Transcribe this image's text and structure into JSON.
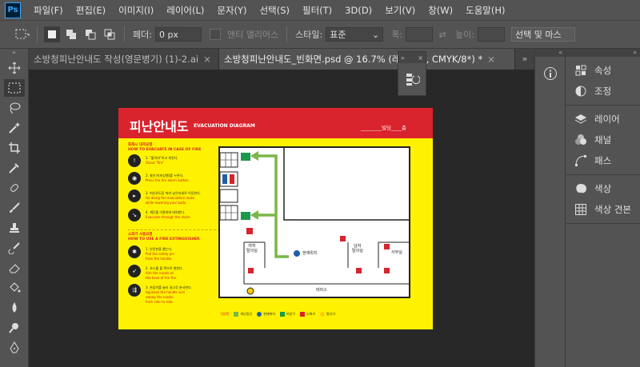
{
  "app": {
    "logo": "Ps"
  },
  "menu": [
    "파일(F)",
    "편집(E)",
    "이미지(I)",
    "레이어(L)",
    "문자(Y)",
    "선택(S)",
    "필터(T)",
    "3D(D)",
    "보기(V)",
    "창(W)",
    "도움말(H)"
  ],
  "options": {
    "feather_label": "페더:",
    "feather_value": "0 px",
    "antialias_label": "앤티 앨리어스",
    "style_label": "스타일:",
    "style_value": "표준",
    "width_label": "폭:",
    "height_label": "높이:",
    "select_mask_label": "선택 및 마스"
  },
  "tabs": [
    {
      "label": "소방청피난안내도 작성(영문병기) (1)-2.ai",
      "active": false
    },
    {
      "label": "소방청피난안내도_빈화면.psd @ 16.7% (레이어 4, CMYK/8*) *",
      "active": true
    }
  ],
  "right_collapsed_icons": [
    "info-icon"
  ],
  "panels": [
    {
      "group": [
        {
          "label": "속성",
          "icon": "properties-icon"
        },
        {
          "label": "조정",
          "icon": "adjustments-icon"
        }
      ]
    },
    {
      "group": [
        {
          "label": "레이어",
          "icon": "layers-icon"
        },
        {
          "label": "채널",
          "icon": "channels-icon"
        },
        {
          "label": "패스",
          "icon": "paths-icon"
        }
      ]
    },
    {
      "group": [
        {
          "label": "색상",
          "icon": "color-icon"
        },
        {
          "label": "색상 견본",
          "icon": "swatches-icon"
        }
      ]
    }
  ],
  "document": {
    "title": "피난안내도",
    "subtitle": "EVACUATION DIAGRAM",
    "floor_line": "________빌딩____층",
    "fire_section": {
      "title_kr": "화재시 대피요령",
      "title_en": "HOW TO EVACUATE IN CASE OF FIRE",
      "steps": [
        {
          "kr": "1. \"불이야\"하고 외친다.",
          "en": "Shout \"fire\""
        },
        {
          "kr": "2. 발신기(비상벨)를 누른다.",
          "en": "Press the fire alarm button."
        },
        {
          "kr": "3. 피난유도등 따라 낮은자세로 이동한다.",
          "en": "Go along the evacuation route",
          "en2": "while lowering your body."
        },
        {
          "kr": "4. 계단을 이용하여 대피한다.",
          "en": "Evacuate through the stairs."
        }
      ]
    },
    "ext_section": {
      "title_kr": "소화기 사용요령",
      "title_en": "HOW TO USE A FIRE EXTINGUISHER",
      "steps": [
        {
          "kr": "1. 안전핀을 뽑는다.",
          "en": "Pull the safety pin",
          "en2": "from the handle."
        },
        {
          "kr": "2. 호스를 불 쪽으로 향한다.",
          "en": "Aim the nozzle at",
          "en2": "the base of the fire."
        },
        {
          "kr": "3. 손잡이를 눌러 골고루 분사한다.",
          "en": "Squeeze the handle and",
          "en2": "sweep the nozzle",
          "en3": "from side to side."
        }
      ]
    },
    "rooms": {
      "women": "여자\n탈의실",
      "men": "남자\n탈의실",
      "office": "사무실",
      "current": "현재위치",
      "terrace": "테라스"
    },
    "legend": {
      "title": "[범례]",
      "items": [
        {
          "kr": "피난동선",
          "en": "Evacuation Route"
        },
        {
          "kr": "현재위치",
          "en": "You are here"
        },
        {
          "kr": "비상구",
          "en": "Emergency Exit"
        },
        {
          "kr": "소화기",
          "en": "Fire Extinguisher"
        },
        {
          "kr": "발신기",
          "en": "Fire Alarm"
        }
      ]
    }
  },
  "colors": {
    "red": "#d9232d",
    "yellow": "#fff200",
    "green": "#7ab648",
    "exit_green": "#1a9b4b"
  }
}
